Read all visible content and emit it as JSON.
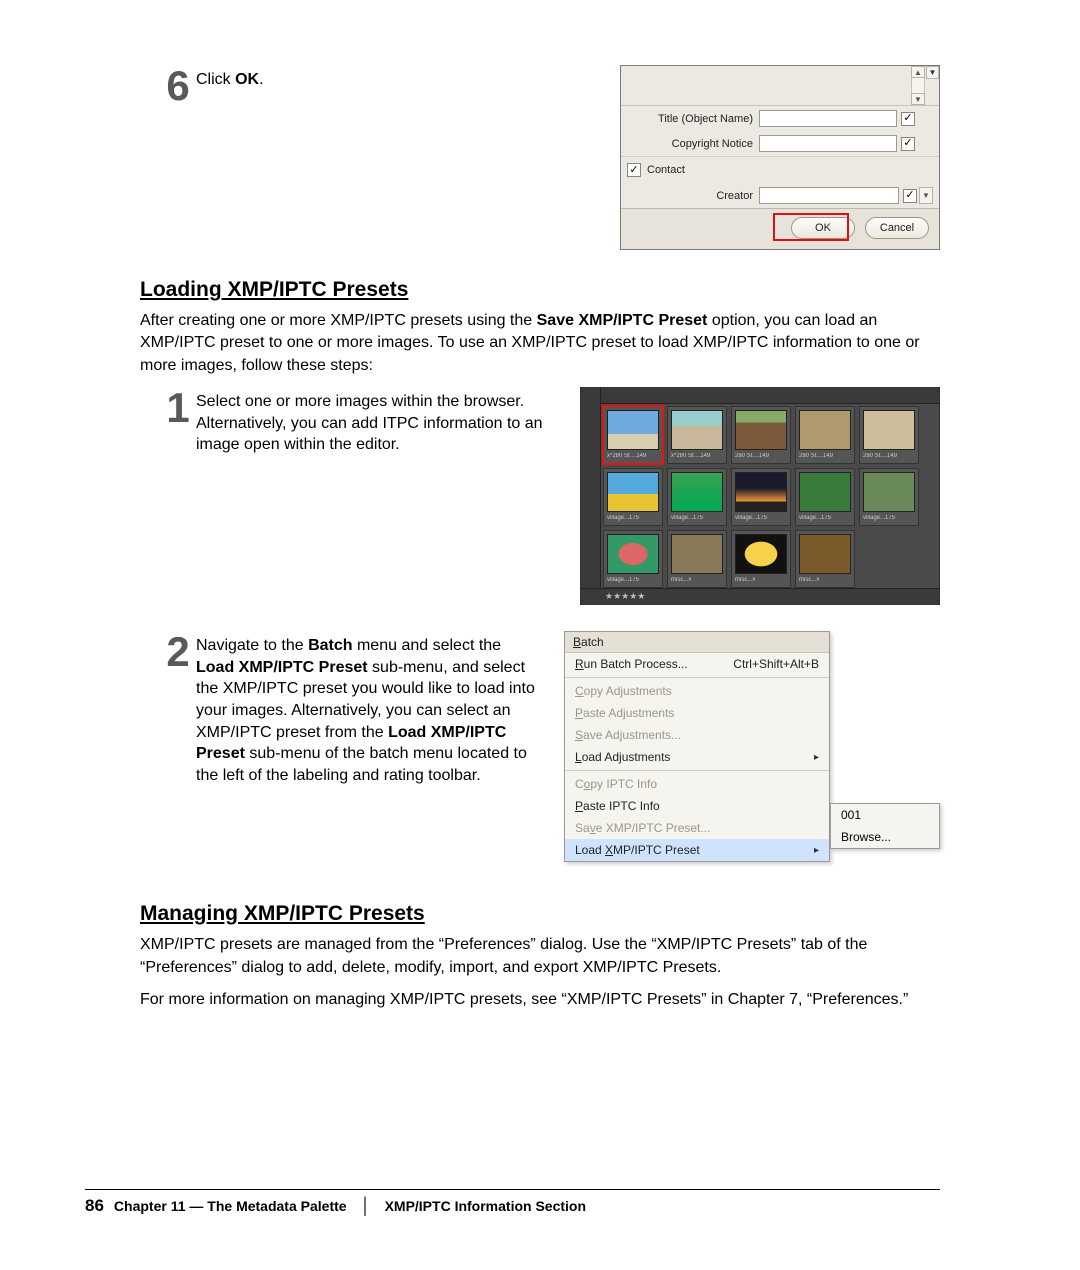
{
  "step6": {
    "num": "6",
    "prefix": "Click ",
    "bold": "OK",
    "suffix": "."
  },
  "fig1": {
    "fields": {
      "title_label": "Title (Object Name)",
      "copyright_label": "Copyright Notice",
      "creator_label": "Creator"
    },
    "contact_section": "Contact",
    "buttons": {
      "ok": "OK",
      "cancel": "Cancel"
    }
  },
  "loading": {
    "heading": "Loading XMP/IPTC Presets",
    "para_a": "After creating one or more XMP/IPTC presets using the ",
    "para_b_bold": "Save XMP/IPTC Preset",
    "para_c": " option, you can load an XMP/IPTC preset to one or more images. To use an XMP/IPTC preset to load XMP/IPTC information to one or more images, follow these steps:",
    "step1": {
      "num": "1",
      "text": "Select one or more images within the browser. Alternatively, you can add ITPC information to an image open within the editor."
    },
    "step2": {
      "num": "2",
      "seg1": "Navigate to the ",
      "b1": "Batch",
      "seg2": " menu and select the ",
      "b2": "Load XMP/IPTC Preset",
      "seg3": " sub-menu, and select the XMP/IPTC preset you would like to load into your images. Alternatively, you can select an XMP/IPTC preset from the ",
      "b3": "Load XMP/IPTC Preset",
      "seg4": " sub-menu of the batch menu located to the left of the labeling and rating toolbar."
    }
  },
  "fig2": {
    "stars": "★★★★★",
    "thumbs": [
      {
        "cls": "t-sky",
        "name": "x*280 St....149",
        "sel": true
      },
      {
        "cls": "t-town",
        "name": "x*280 St....149"
      },
      {
        "cls": "t-crowd",
        "name": "280 St....149"
      },
      {
        "cls": "t-street",
        "name": "280 St....149"
      },
      {
        "cls": "t-arch",
        "name": "280 St....149"
      },
      {
        "cls": "t-bus",
        "name": "village...175"
      },
      {
        "cls": "t-tree",
        "name": "village...175"
      },
      {
        "cls": "t-sunset",
        "name": "village...175"
      },
      {
        "cls": "t-bird",
        "name": "village...175"
      },
      {
        "cls": "t-bird2",
        "name": "village...175"
      },
      {
        "cls": "t-flower",
        "name": "village...175"
      },
      {
        "cls": "t-stone",
        "name": "misc...x"
      },
      {
        "cls": "t-watch",
        "name": "misc...x"
      },
      {
        "cls": "t-door",
        "name": "misc...x"
      }
    ]
  },
  "fig3": {
    "title": "Batch",
    "items": [
      {
        "label": "Run Batch Process...",
        "accel": "Ctrl+Shift+Alt+B",
        "disabled": false
      },
      {
        "sep": true
      },
      {
        "label": "Copy Adjustments",
        "disabled": true
      },
      {
        "label": "Paste Adjustments",
        "disabled": true
      },
      {
        "label": "Save Adjustments...",
        "disabled": true
      },
      {
        "label": "Load Adjustments",
        "submenu": true
      },
      {
        "sep": true
      },
      {
        "label": "Copy IPTC Info",
        "disabled": true
      },
      {
        "label": "Paste IPTC Info"
      },
      {
        "label": "Save XMP/IPTC Preset...",
        "disabled": true
      },
      {
        "label": "Load XMP/IPTC Preset",
        "submenu": true,
        "hover": true
      }
    ],
    "sub": [
      "001",
      "Browse..."
    ],
    "acc": {
      "batch": "B",
      "run": "R",
      "copy": "C",
      "paste": "P",
      "save": "S",
      "load": "L",
      "copy2": "o",
      "save2": "v",
      "load2": "X"
    }
  },
  "managing": {
    "heading": "Managing XMP/IPTC Presets",
    "p1": "XMP/IPTC presets are managed from the “Preferences” dialog. Use the “XMP/IPTC Presets” tab of the “Preferences” dialog to add, delete, modify, import, and export XMP/IPTC Presets.",
    "p2": "For more information on managing XMP/IPTC presets, see “XMP/IPTC Presets” in Chapter 7, “Preferences.”"
  },
  "footer": {
    "page": "86",
    "chapter": "Chapter 11 — The Metadata Palette",
    "section": "XMP/IPTC Information Section"
  }
}
